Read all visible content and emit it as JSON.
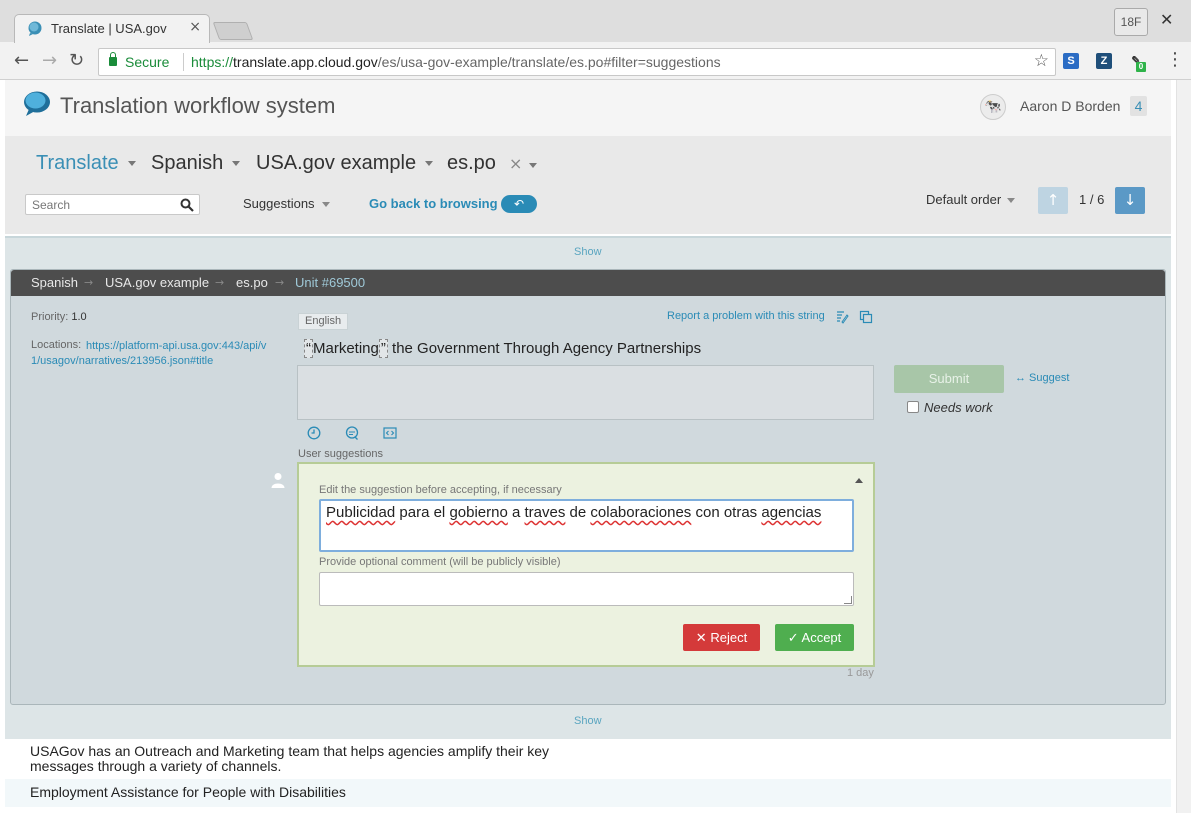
{
  "browser": {
    "tab_title": "Translate | USA.gov",
    "window_badge": "18F",
    "secure_label": "Secure",
    "url_scheme": "https://",
    "url_host": "translate.app.cloud.gov",
    "url_path": "/es/usa-gov-example/translate/es.po#filter=suggestions",
    "extension_badge": "0"
  },
  "header": {
    "app_title": "Translation workflow system",
    "username": "Aaron D Borden",
    "user_count": "4"
  },
  "nav": {
    "crumbs": [
      "Translate",
      "Spanish",
      "USA.gov example",
      "es.po"
    ],
    "clear": "×",
    "search_placeholder": "Search",
    "filter": "Suggestions",
    "go_back": "Go back to browsing",
    "order": "Default order",
    "counter": "1 / 6"
  },
  "units": {
    "show_label": "Show",
    "show_label_bottom": "Show",
    "unit_breadcrumb": [
      "Spanish",
      "USA.gov example",
      "es.po",
      "Unit #69500"
    ],
    "priority_label": "Priority:",
    "priority_value": "1.0",
    "locations_label": "Locations:",
    "locations_value": "https://platform-api.usa.gov:443/api/v1/usagov/narratives/213956.json#title",
    "source_lang": "English",
    "report_link": "Report a problem with this string",
    "source_ph_open": "“",
    "source_word": "Marketing",
    "source_ph_close": "”",
    "source_rest": " the Government Through Agency Partnerships",
    "submit": "Submit",
    "suggest": "↔ Suggest",
    "needs_work": "Needs work",
    "user_suggestions": "User suggestions",
    "edit_label": "Edit the suggestion before accepting, if necessary",
    "suggestion_text": [
      "Publicidad",
      "para el",
      "gobierno",
      "a",
      "traves",
      "de",
      "colaboraciones",
      "con otras",
      "agencias"
    ],
    "comment_label": "Provide optional comment (will be publicly visible)",
    "reject": "Reject",
    "accept": "Accept",
    "time_ago": "1 day"
  },
  "rows": [
    "USAGov has an Outreach and Marketing team that helps agencies amplify their key messages through a variety of channels.",
    "Employment Assistance for People with Disabilities"
  ],
  "colors": {
    "link": "#2a8bb6",
    "reject": "#d43a3a",
    "accept": "#4fae4f",
    "unit_header": "#4d4d4d"
  }
}
